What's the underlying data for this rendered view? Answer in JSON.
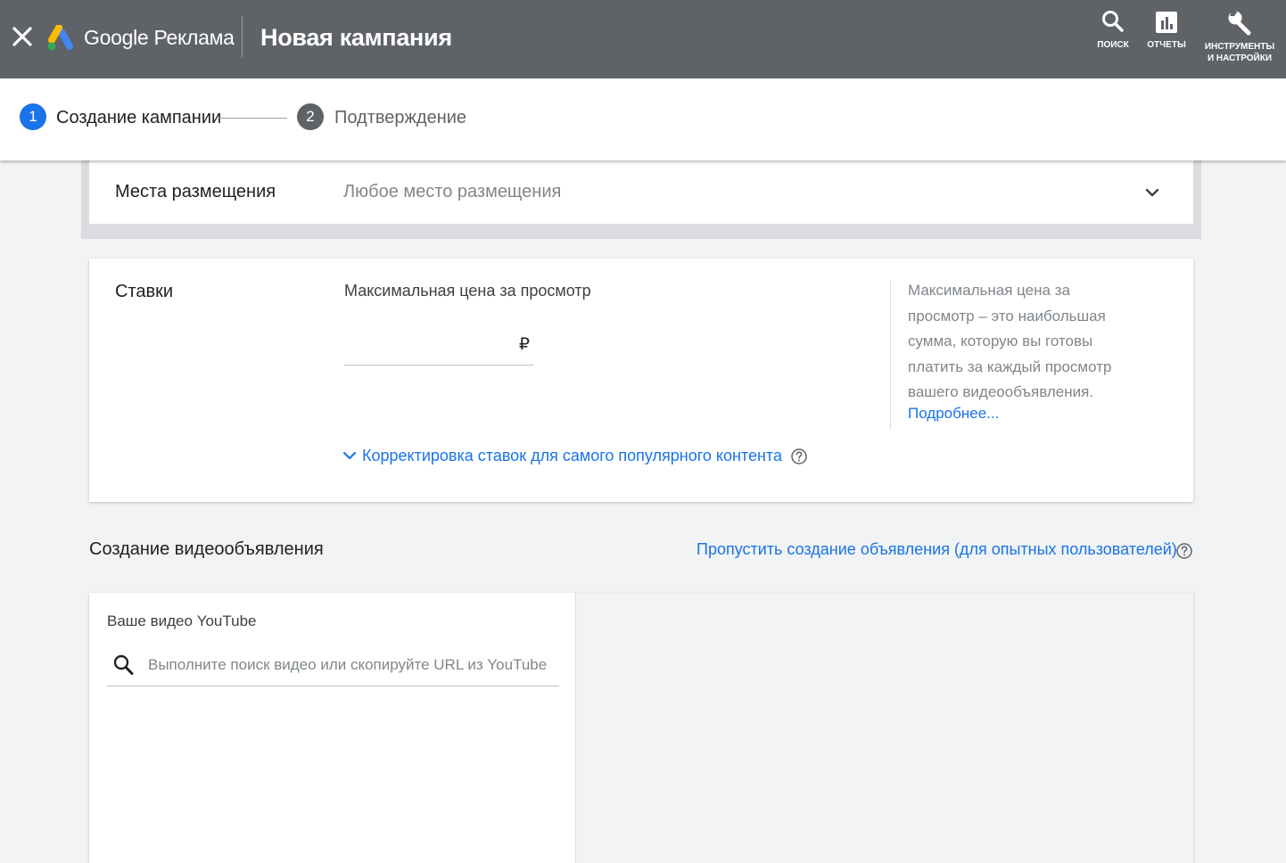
{
  "header": {
    "close_icon": "close-icon",
    "logo_icon": "google-ads-logo",
    "product_name": "Google Реклама",
    "page_title": "Новая кампания",
    "tools": [
      {
        "icon": "search-icon",
        "label": "ПОИСК"
      },
      {
        "icon": "reports-icon",
        "label": "ОТЧЕТЫ"
      },
      {
        "icon": "wrench-icon",
        "label": "ИНСТРУМЕНТЫ\nИ НАСТРОЙКИ"
      }
    ],
    "colors": {
      "bar": "#5f6368"
    }
  },
  "stepper": {
    "steps": [
      {
        "number": "1",
        "label": "Создание кампании",
        "state": "active"
      },
      {
        "number": "2",
        "label": "Подтверждение",
        "state": "inactive"
      }
    ],
    "colors": {
      "active": "#1a73e8",
      "inactive": "#5f6368"
    }
  },
  "placement": {
    "label": "Места размещения",
    "value": "Любое место размещения",
    "icon": "chevron-down-icon"
  },
  "bids": {
    "label": "Ставки",
    "field_label": "Максимальная цена за просмотр",
    "value": "",
    "currency": "₽",
    "help_text": "Максимальная цена за просмотр – это наибольшая сумма, которую вы готовы платить за каждый просмотр вашего видеообъявления.",
    "help_link": "Подробнее...",
    "adjust_link": "Корректировка ставок для самого популярного контента",
    "help_icon": "help-circle-icon"
  },
  "video_ad": {
    "heading": "Создание видеообъявления",
    "skip_link": "Пропустить создание объявления (для опытных пользователей)",
    "youtube_label": "Ваше видео YouTube",
    "search_placeholder": "Выполните поиск видео или скопируйте URL из YouTube",
    "search_value": ""
  },
  "colors": {
    "accent": "#1a73e8",
    "background": "#f1f3f4",
    "card": "#ffffff"
  }
}
